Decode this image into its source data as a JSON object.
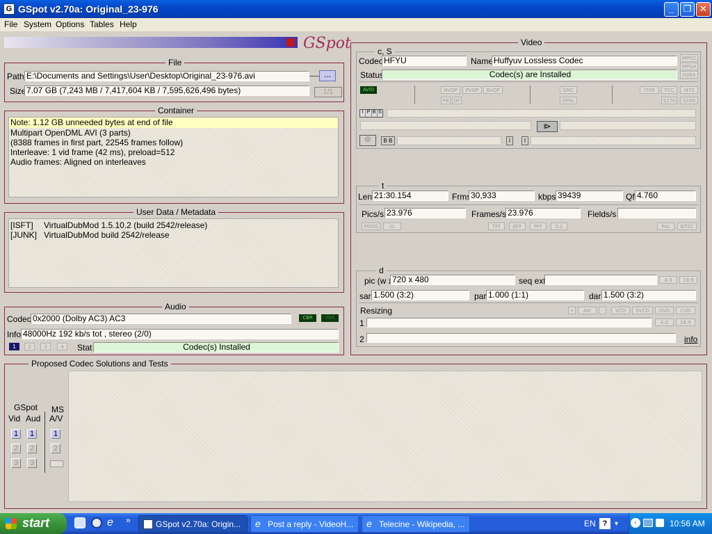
{
  "window": {
    "title": "GSpot v2.70a: Original_23-976",
    "controls": [
      "_",
      "❐",
      "✕"
    ]
  },
  "menu": [
    "File",
    "System",
    "Options",
    "Tables",
    "Help"
  ],
  "logo": "GSpot",
  "file": {
    "title": "File",
    "path_label": "Path",
    "path": "E:\\Documents and Settings\\User\\Desktop\\Original_23-976.avi",
    "browse": "...",
    "size_label": "Size",
    "size": "7.07 GB (7,243 MB / 7,417,604 KB / 7,595,626,496 bytes)",
    "page": "1/1"
  },
  "container": {
    "title": "Container",
    "lines": [
      "Note: 1.12 GB unneeded bytes at end of file",
      "Multipart OpenDML AVI (3 parts)",
      "(8388 frames in first part, 22545 frames follow)",
      "Interleave: 1 vid frame (42 ms), preload=512",
      "Audio frames: Aligned on interleaves"
    ]
  },
  "metadata": {
    "title": "User Data / Metadata",
    "rows": [
      {
        "tag": "[ISFT]",
        "value": "VirtualDubMod 1.5.10.2 (build 2542/release)"
      },
      {
        "tag": "[JUNK]",
        "value": "VirtualDubMod build 2542/release"
      }
    ]
  },
  "audio": {
    "title": "Audio",
    "codec_label": "Codec",
    "codec": "0x2000 (Dolby AC3) AC3",
    "cbr": "CBR",
    "vbr": "VBR",
    "info_label": "Info",
    "info": "48000Hz  192 kb/s tot , stereo (2/0)",
    "streams": [
      "1",
      "2",
      "3",
      "4"
    ],
    "stat_label": "Stat",
    "stat": "Codec(s) Installed"
  },
  "video": {
    "title": "Video",
    "cs_title": "c, S",
    "codec_label": "Codec",
    "codec": "HFYU",
    "name_label": "Name",
    "name": "Huffyuv Lossless Codec",
    "status_label": "Status",
    "status": "Codec(s) are Installed",
    "fourcc_side": [
      "MPG2",
      "MPG4",
      "H264"
    ],
    "flags_row1": [
      "AVID",
      "NVOP",
      "PVOP",
      "BVOP",
      "GMC",
      "I709",
      "FCC",
      "I470"
    ],
    "flags_row2": [
      "PB",
      "DF",
      "OPEL",
      "S170",
      "S240"
    ],
    "ipbs": [
      "I",
      "P",
      "B",
      "S"
    ],
    "t_title": "t",
    "len_label": "Len",
    "len": "21:30.154",
    "frms_label": "Frms",
    "frms": "30,933",
    "kbps_label": "kbps",
    "kbps": "39439",
    "qf_label": "Qf",
    "qf": "4.760",
    "pics_label": "Pics/s",
    "pics": "23.976",
    "frames_label": "Frames/s",
    "frames": "23.976",
    "fields_label": "Fields/s",
    "fields": "",
    "flags_row3": [
      "PROG",
      "I/L",
      "TFF",
      "BFF",
      "PFF",
      "3:2",
      "PAL",
      "NTSC"
    ],
    "d_title": "d",
    "pic_label": "pic (w x",
    "pic": "720 x 480",
    "seqext_label": "seq ext",
    "seqext": "",
    "ar": [
      "4:3",
      "16:9"
    ],
    "sar_label": "sar",
    "sar": "1.500 (3:2)",
    "par_label": "par",
    "par": "1.000 (1:1)",
    "dar_label": "dar",
    "dar": "1.500 (3:2)",
    "resizing_label": "Resizing",
    "resize_btns": [
      "+",
      "AVI",
      "-",
      "VCD",
      "SVCD",
      "DVD",
      "CVD"
    ],
    "row1": "1",
    "row2": "2",
    "info_link": "info"
  },
  "solutions": {
    "title": "Proposed Codec Solutions and Tests",
    "gspot_label": "GSpot",
    "vid_label": "Vid",
    "aud_label": "Aud",
    "ms_label": "MS",
    "av_label": "A/V",
    "vid": [
      "1",
      "2",
      "3"
    ],
    "aud": [
      "1",
      "2",
      "3"
    ],
    "av": [
      "1",
      "2"
    ]
  },
  "taskbar": {
    "start": "start",
    "tasks": [
      "GSpot v2.70a: Origin...",
      "Post a reply - VideoH...",
      "Telecine - Wikipedia, ..."
    ],
    "lang": "EN",
    "clock": "10:56 AM",
    "chevron": "»"
  },
  "colors": {
    "accent": "#8a2a4a",
    "titlebar": "#0347c9",
    "green": "#dcf5d6",
    "highlight": "#ffffc0"
  }
}
